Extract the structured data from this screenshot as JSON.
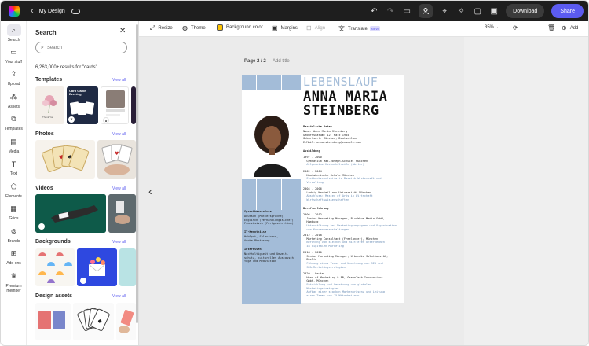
{
  "topbar": {
    "doc_title": "My Design",
    "download_label": "Download",
    "share_label": "Share"
  },
  "rail": {
    "items": [
      {
        "label": "Search",
        "icon": "search-icon"
      },
      {
        "label": "Your stuff",
        "icon": "folder-icon"
      },
      {
        "label": "Upload",
        "icon": "upload-icon"
      },
      {
        "label": "Assets",
        "icon": "assets-icon"
      },
      {
        "label": "Templates",
        "icon": "templates-icon"
      },
      {
        "label": "Media",
        "icon": "media-icon"
      },
      {
        "label": "Text",
        "icon": "text-icon"
      },
      {
        "label": "Elements",
        "icon": "elements-icon"
      },
      {
        "label": "Grids",
        "icon": "grids-icon"
      },
      {
        "label": "Brands",
        "icon": "brands-icon"
      },
      {
        "label": "Add-ons",
        "icon": "addons-icon"
      },
      {
        "label": "Premium member",
        "icon": "crown-icon"
      }
    ]
  },
  "panel": {
    "title": "Search",
    "search_placeholder": "Search",
    "results": "6,263,000+ results for \"cards\"",
    "view_all": "View all",
    "sections": {
      "templates": "Templates",
      "photos": "Photos",
      "videos": "Videos",
      "backgrounds": "Backgrounds",
      "design_assets": "Design assets"
    },
    "template_texts": {
      "thank_you": "Thank You",
      "card_game": "Card Game Evening"
    }
  },
  "toolbar": {
    "resize": "Resize",
    "theme": "Theme",
    "background_color": "Background color",
    "margins": "Margins",
    "align": "Align",
    "translate": "Translate",
    "new_badge": "NEW",
    "zoom": "35%",
    "add": "Add"
  },
  "canvas": {
    "page_label_bold": "Page 2 / 2",
    "page_label_sep": " - ",
    "add_title": "Add title"
  },
  "resume": {
    "heading": "LEBENSLAUF",
    "first_name": "ANNA MARIA",
    "last_name": "STEINBERG",
    "personal_heading": "Persönliche Daten",
    "personal_lines": "Name: Anna Maria Steinberg\nGeburtsdatum: 12. März 1985\nGeburtsort: München, Deutschland\nE-Mail: anna.steinberg@example.com",
    "education_heading": "Ausbildung",
    "edu_1": "1997 - 2000\n  Gymnasium Max-Joseph-Schule, München",
    "edu_1_sub": "  Allgemeine Hochschulreife (Abitur)",
    "edu_2": "2002 - 2004\n  Kaufmännische Schule München",
    "edu_2_sub": "  Fachhochschulreife in Bereich Wirtschaft und\n  Verwaltung",
    "edu_3": "2004 - 2006\n  Ludwig-Maximilians-Universität München",
    "edu_3_sub": "  Abschluss: Master of Arts in Wirtschaft\n  Wirtschaftswissenschaften",
    "work_heading": "Berufserfahrung",
    "work_1": "2006 - 2012\n  Junior Marketing Manager, BlueWave Media GmbH,\n  Hamburg",
    "work_1_sub": "  Unterstützung bei Marketingkampagnen und Organisation\n  von Kundenveranstaltungen",
    "work_2": "2012 - 2018\n  Marketing Consultant (Freelancer), München",
    "work_2_sub": "  Beratung von kleinen und mittleren Unternehmen\n  in digitalen Marketing",
    "work_3": "2018 - 2020\n  Senior Marketing Manager, Urbandia Solutions AG,\n  Berlin",
    "work_3_sub": "  Führung eines Teams und Umsetzung von SEO und\n  SEA-Marketingstrategien",
    "work_4": "2020 - heute\n  Head of Marketing & PR, GreenTech Innovations\n  GmbH, München",
    "work_4_sub": "  Entwicklung und Umsetzung von globalen\n  Marketingstrategien\n  Aufbau einer starken Markenpräsenz und Leitung\n  eines Teams von 15 Mitarbeitern",
    "lang_heading": "Sprachkenntnisse",
    "lang_lines": "Deutsch (Muttersprache)\nEnglisch (Verhandlungssicher)\nFranzösisch (Fortgeschritten)",
    "it_heading": "IT-Kenntnisse",
    "it_lines": "HubSpot, Salesforce,\nAdobe Photoshop",
    "interests_heading": "Interessen",
    "interests_lines": "Nachhaltigkeit und Umwelt-\nschutz, kulturelles Austausch\nYoga und Meditation"
  },
  "colors": {
    "accent": "#5b5bf0",
    "resume_blue": "#a3bcd8",
    "topbar": "#1e1e1e"
  }
}
